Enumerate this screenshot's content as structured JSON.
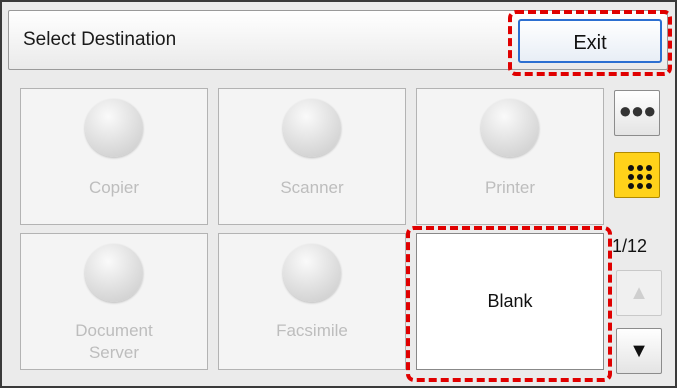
{
  "header": {
    "title": "Select Destination",
    "exit_label": "Exit"
  },
  "tiles": [
    {
      "label": "Copier"
    },
    {
      "label": "Scanner"
    },
    {
      "label": "Printer"
    },
    {
      "label_line1": "Document",
      "label_line2": "Server"
    },
    {
      "label": "Facsimile"
    },
    {
      "label": "Blank"
    }
  ],
  "side": {
    "more_icon": "three-dots-icon",
    "grid_icon": "grid-dots-icon",
    "page_indicator": "1/12",
    "up_arrow": "▲",
    "down_arrow": "▼"
  },
  "colors": {
    "highlight": "#e00000",
    "exit_border": "#2c6fd1",
    "active_button": "#ffd21a"
  }
}
